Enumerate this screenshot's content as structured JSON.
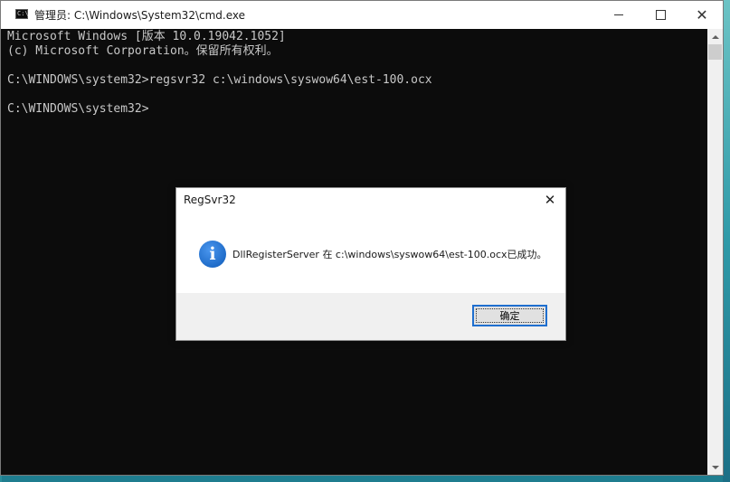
{
  "window": {
    "title": "管理员: C:\\Windows\\System32\\cmd.exe",
    "icon_label": "C:\\",
    "controls": [
      "minimize-icon",
      "maximize-icon",
      "close-icon"
    ]
  },
  "console": {
    "lines": [
      "Microsoft Windows [版本 10.0.19042.1052]",
      "(c) Microsoft Corporation。保留所有权利。",
      "",
      "C:\\WINDOWS\\system32>regsvr32 c:\\windows\\syswow64\\est-100.ocx",
      "",
      "C:\\WINDOWS\\system32>"
    ],
    "background": "#0c0c0c",
    "foreground": "#c8c8c8"
  },
  "dialog": {
    "title": "RegSvr32",
    "close_glyph": "✕",
    "icon": "info-icon",
    "icon_glyph": "i",
    "message": "DllRegisterServer 在 c:\\windows\\syswow64\\est-100.ocx已成功。",
    "ok_label": "确定"
  }
}
